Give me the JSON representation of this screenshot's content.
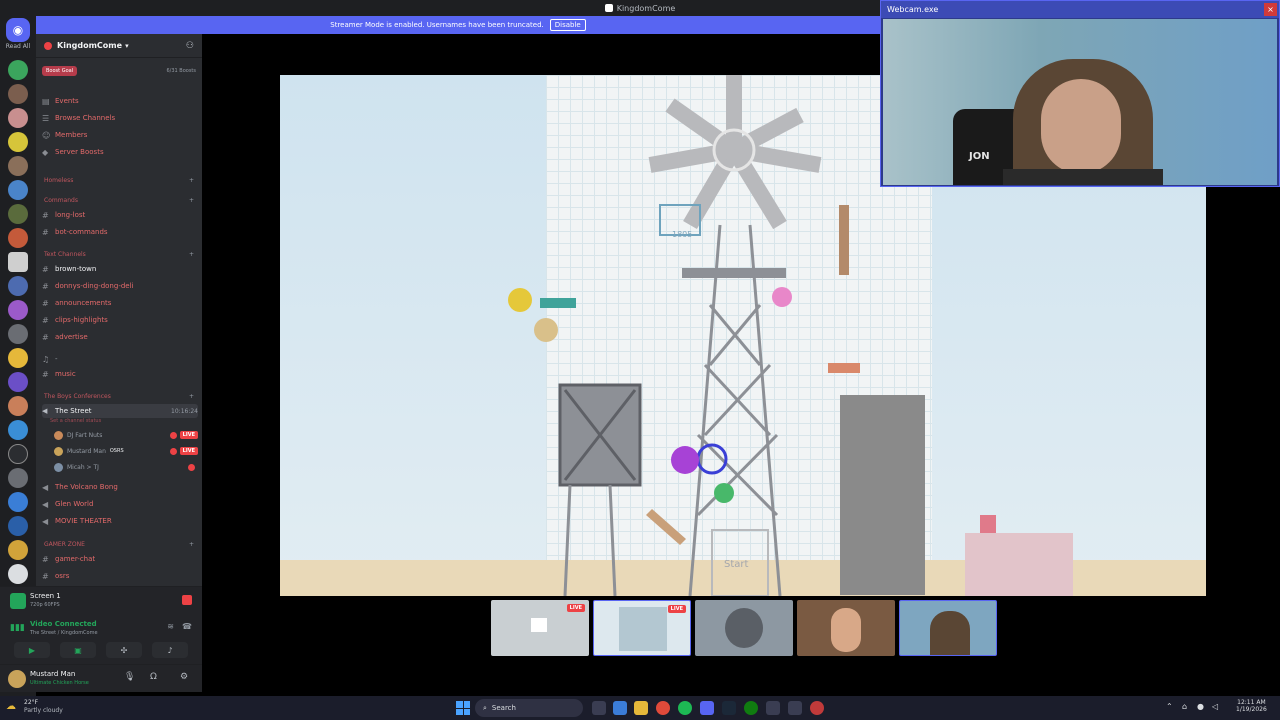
{
  "titlebar": {
    "title": "KingdomCome"
  },
  "streamer_mode": {
    "message": "Streamer Mode is enabled. Usernames have been truncated.",
    "button": "Disable"
  },
  "rail": {
    "read_all": "Read All"
  },
  "server": {
    "name": "KingdomCome",
    "boost_goal": "Boost Goal",
    "boost_count": "6/31 Boosts"
  },
  "top_items": [
    {
      "label": "Events",
      "icon": "calendar-icon"
    },
    {
      "label": "Browse Channels",
      "icon": "browse-icon"
    },
    {
      "label": "Members",
      "icon": "members-icon"
    },
    {
      "label": "Server Boosts",
      "icon": "boost-icon"
    }
  ],
  "categories": {
    "homeless": "Homeless",
    "commands": "Commands",
    "text_channels": "Text Channels",
    "boys_conferences": "The Boys Conferences",
    "gamer_zone": "GAMER ZONE"
  },
  "channels": {
    "long_lost": "long-lost",
    "bot_commands": "bot-commands",
    "brown_town": "brown-town",
    "donnys": "donnys-ding-dong-deli",
    "announcements": "announcements",
    "clips": "clips-highlights",
    "advertise": "advertise",
    "dash": "-",
    "music": "music",
    "volcano": "The Volcano Bong",
    "glen": "Glen World",
    "movie": "MOVIE THEATER",
    "gamer_chat": "gamer-chat",
    "osrs": "osrs"
  },
  "voice": {
    "the_street": "The Street",
    "time": "10:16:24",
    "status": "Set a channel status",
    "members": [
      {
        "name": "DJ Fart Nuts",
        "live": "LIVE"
      },
      {
        "name": "Mustard Man",
        "tag": "OSRS",
        "live": "LIVE"
      },
      {
        "name": "Micah > TJ"
      }
    ]
  },
  "screen": {
    "title": "Screen 1",
    "sub": "720p 60FPS"
  },
  "connection": {
    "title": "Video Connected",
    "sub": "The Street / KingdomCome"
  },
  "user": {
    "name": "Mustard Man",
    "status": "Ultimate Chicken Horse"
  },
  "game": {
    "start_label": "Start",
    "score_label": "1805"
  },
  "webcam": {
    "title": "Webcam.exe",
    "shirt_text": "JON",
    "close": "×"
  },
  "thumbnails": [
    {
      "live": "LIVE"
    },
    {
      "live": "LIVE"
    },
    {},
    {},
    {}
  ],
  "taskbar": {
    "temp": "22°F",
    "weather": "Partly cloudy",
    "search": "Search",
    "time": "12:11 AM",
    "date": "1/19/2026"
  },
  "colors": {
    "accent": "#5865f2",
    "live": "#ed4245",
    "connected": "#23a55a",
    "channel_text": "#e36a6a"
  }
}
